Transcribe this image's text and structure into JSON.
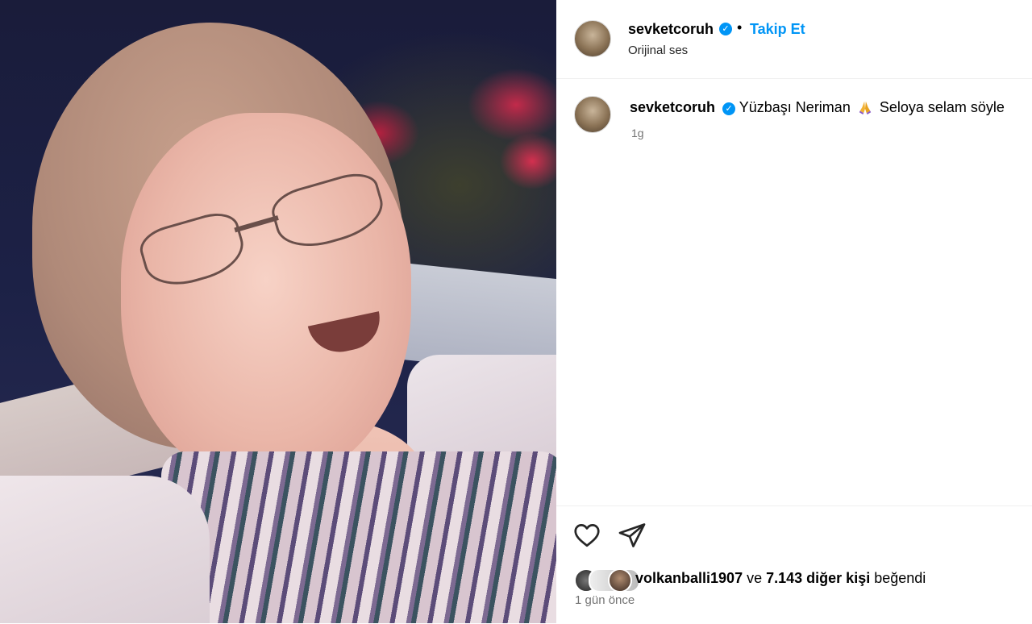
{
  "post": {
    "username": "sevketcoruh",
    "follow_label": "Takip Et",
    "separator": "•",
    "audio": "Orijinal ses"
  },
  "caption": {
    "username": "sevketcoruh",
    "text_before_emoji": "Yüzbaşı Neriman",
    "emoji": "folded-hands-emoji",
    "text_after_emoji": "Seloya selam söyle",
    "time": "1g"
  },
  "actions": {
    "like_icon": "heart-icon",
    "share_icon": "paper-plane-icon"
  },
  "likes": {
    "liker": "volkanballi1907",
    "connector": "ve",
    "others": "7.143 diğer kişi",
    "suffix": "beğendi"
  },
  "posted": "1 gün önce",
  "colors": {
    "accent": "#0095f6",
    "muted": "#737373",
    "border": "#efefef"
  }
}
